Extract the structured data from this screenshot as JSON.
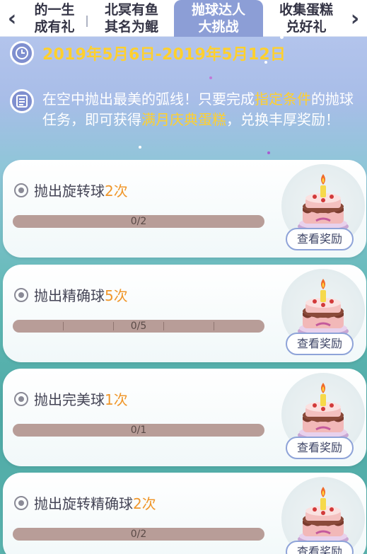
{
  "tabs": [
    {
      "line1": "的一生",
      "line2": "成有礼",
      "active": false
    },
    {
      "line1": "北冥有鱼",
      "line2": "其名为鲲",
      "active": false
    },
    {
      "line1": "抛球达人",
      "line2": "大挑战",
      "active": true
    },
    {
      "line1": "收集蛋糕",
      "line2": "兑好礼",
      "active": false
    }
  ],
  "nav": {
    "left_arrow": "‹",
    "right_arrow": "›"
  },
  "event": {
    "date_range": "2019年5月6日-2019年5月12日",
    "desc_part1": "在空中抛出最美的弧线！只要完成",
    "desc_highlight1": "指定条件",
    "desc_part2": "的抛球任务，即可获得",
    "desc_highlight2": "满月庆典蛋糕",
    "desc_part3": "，兑换丰厚奖励！"
  },
  "tasks": [
    {
      "label": "抛出旋转球",
      "count": "2次",
      "progress": "0/2",
      "reward_button": "查看奖励"
    },
    {
      "label": "抛出精确球",
      "count": "5次",
      "progress": "0/5",
      "reward_button": "查看奖励"
    },
    {
      "label": "抛出完美球",
      "count": "1次",
      "progress": "0/1",
      "reward_button": "查看奖励"
    },
    {
      "label": "抛出旋转精确球",
      "count": "2次",
      "progress": "0/2",
      "reward_button": "查看奖励"
    }
  ],
  "colors": {
    "accent": "#ffd02e",
    "active_tab": "#8c9ed6",
    "count": "#f0972b"
  }
}
